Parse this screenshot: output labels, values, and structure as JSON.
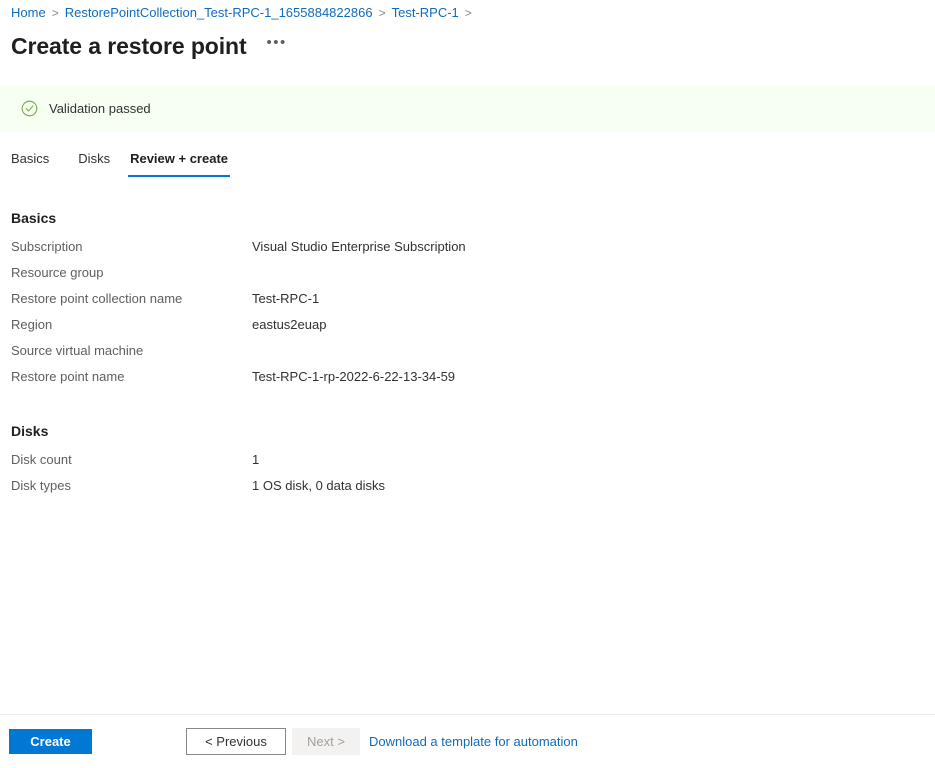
{
  "breadcrumb": {
    "separator": ">",
    "items": [
      {
        "label": "Home"
      },
      {
        "label": "RestorePointCollection_Test-RPC-1_1655884822866"
      },
      {
        "label": "Test-RPC-1"
      }
    ],
    "trailing_separator": ">"
  },
  "header": {
    "title": "Create a restore point",
    "more_label": "•••"
  },
  "validation": {
    "message": "Validation passed",
    "icon": "check-circle-icon",
    "background_color": "#f6fff2",
    "icon_color": "#74a642"
  },
  "tabs": [
    {
      "label": "Basics",
      "active": false
    },
    {
      "label": "Disks",
      "active": false
    },
    {
      "label": "Review + create",
      "active": true
    }
  ],
  "sections": [
    {
      "title": "Basics",
      "rows": [
        {
          "label": "Subscription",
          "value": "Visual Studio Enterprise Subscription"
        },
        {
          "label": "Resource group",
          "value": ""
        },
        {
          "label": "Restore point collection name",
          "value": "Test-RPC-1"
        },
        {
          "label": "Region",
          "value": "eastus2euap"
        },
        {
          "label": "Source virtual machine",
          "value": ""
        },
        {
          "label": "Restore point name",
          "value": "Test-RPC-1-rp-2022-6-22-13-34-59"
        }
      ]
    },
    {
      "title": "Disks",
      "rows": [
        {
          "label": "Disk count",
          "value": "1"
        },
        {
          "label": "Disk types",
          "value": "1 OS disk, 0 data disks"
        }
      ]
    }
  ],
  "footer": {
    "create_label": "Create",
    "previous_label": "< Previous",
    "next_label": "Next >",
    "download_template_label": "Download a template for automation",
    "primary_color": "#0078d4",
    "link_color": "#0f6cbd"
  }
}
